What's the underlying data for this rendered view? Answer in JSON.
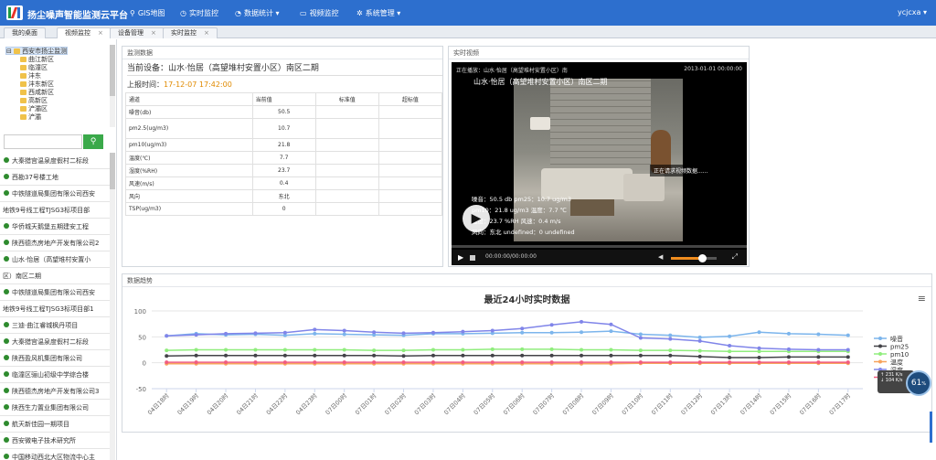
{
  "app": {
    "title": "扬尘噪声智能监测云平台",
    "user": "ycjcxa ▾"
  },
  "nav": [
    {
      "label": "GIS地图",
      "icon": "map-pin-icon",
      "glyph": "⚲"
    },
    {
      "label": "实时监控",
      "icon": "clock-icon",
      "glyph": "◷"
    },
    {
      "label": "数据统计 ▾",
      "icon": "stats-icon",
      "glyph": "◔"
    },
    {
      "label": "视频监控",
      "icon": "video-icon",
      "glyph": "▭"
    },
    {
      "label": "系统管理 ▾",
      "icon": "gear-icon",
      "glyph": "✲"
    }
  ],
  "tabs": [
    {
      "label": "我的桌面",
      "closable": false,
      "active": false
    },
    {
      "label": "视频监控",
      "closable": true,
      "active": true
    },
    {
      "label": "设备管理",
      "closable": true,
      "active": false
    },
    {
      "label": "实时监控",
      "closable": true,
      "active": false
    }
  ],
  "tree": {
    "root": "西安市扬尘监测",
    "children": [
      "曲江新区",
      "临潼区",
      "沣东",
      "沣东新区",
      "西咸新区",
      "高新区",
      "浐灞区",
      "浐灞"
    ]
  },
  "search": {
    "placeholder": "",
    "button": "⚲"
  },
  "sites": [
    {
      "text": "大秦猎宫温泉度假村二标段",
      "dot": true
    },
    {
      "text": "西勘37号楼工地",
      "dot": true
    },
    {
      "text": "中铁隧道局集团有限公司西安",
      "dot": true
    },
    {
      "text": "地铁9号线工程TJSG3标项目部",
      "dot": false
    },
    {
      "text": "华侨城天鹅堡五期建安工程",
      "dot": true
    },
    {
      "text": "陕西德杰房地产开发有限公司2",
      "dot": true
    },
    {
      "text": "山水·怡居（高望堆村安置小",
      "dot": true
    },
    {
      "text": "区）南区二期",
      "dot": false
    },
    {
      "text": "中铁隧道局集团有限公司西安",
      "dot": true
    },
    {
      "text": "地铁9号线工程TJSG3标项目部1",
      "dot": false
    },
    {
      "text": "三迪·曲江睿城枫丹项目",
      "dot": true
    },
    {
      "text": "大秦猎宫温泉度假村二标段",
      "dot": true
    },
    {
      "text": "陕西盈风机集团有限公司",
      "dot": true
    },
    {
      "text": "临潼区骊山初级中学综合楼",
      "dot": true
    },
    {
      "text": "陕西德杰房地产开发有限公司3",
      "dot": true
    },
    {
      "text": "陕西生力置业集团有限公司",
      "dot": true
    },
    {
      "text": "航天新佳园一期项目",
      "dot": true
    },
    {
      "text": "西安微电子技术研究所",
      "dot": true
    },
    {
      "text": "中国移动西北大区物流中心主",
      "dot": true
    }
  ],
  "monitor": {
    "title": "监测数据",
    "device_label": "当前设备：山水·怡居（高望堆村安置小区）南区二期",
    "report_label": "上报时间：",
    "report_time": "17-12-07 17:42:00",
    "headers": [
      "通道",
      "当前值",
      "标准值",
      "超标值"
    ],
    "rows": [
      [
        "噪音(db)",
        "50.5",
        "",
        ""
      ],
      [
        "pm2.5(ug/m3)",
        "10.7",
        "",
        ""
      ],
      [
        "pm10(ug/m3)",
        "21.8",
        "",
        ""
      ],
      [
        "温度(℃)",
        "7.7",
        "",
        ""
      ],
      [
        "湿度(%RH)",
        "23.7",
        "",
        ""
      ],
      [
        "风速(m/s)",
        "0.4",
        "",
        ""
      ],
      [
        "风向",
        "东北",
        "",
        ""
      ],
      [
        "TSP(ug/m3)",
        "0",
        "",
        ""
      ]
    ]
  },
  "video": {
    "title": "实时视频",
    "playing": "正在播放：山水·怡居（高望堆村安置小区）南",
    "stamp": "2013-01-01  00:00:00",
    "caption": "山水·怡居（高望堆村安置小区）南区二期",
    "loading": "正在请求视频数据......",
    "line1": "噪音：50.5 db    pm25：10.7 ug/m3",
    "line2": "pm10：21.8 ug/m3    温度：7.7 ℃",
    "line3": "湿度：23.7 %RH    风速：0.4 m/s",
    "line4": "风向：东北    undefined：0 undefined",
    "time": "00:00:00/00:00:00",
    "play": "▶",
    "volume": "◀",
    "fullscreen": "⤢"
  },
  "trend": {
    "title": "数据趋势"
  },
  "gauge": {
    "value": "61",
    "unit": "%",
    "up": "231 K/s",
    "down": "104 K/s"
  },
  "chart_data": {
    "type": "line",
    "title": "最近24小时实时数据",
    "ylim": [
      -50,
      100
    ],
    "yticks": [
      -50,
      0,
      50,
      100
    ],
    "categories": [
      "04日18时",
      "04日19时",
      "04日20时",
      "04日21时",
      "04日22时",
      "04日23时",
      "07日00时",
      "07日01时",
      "07日02时",
      "07日03时",
      "07日04时",
      "07日05时",
      "07日06时",
      "07日07时",
      "07日08时",
      "07日09时",
      "07日10时",
      "07日11时",
      "07日12时",
      "07日13时",
      "07日14时",
      "07日15时",
      "07日16时",
      "07日17时"
    ],
    "legend_position": "right",
    "series": [
      {
        "name": "噪音",
        "color": "#7cb5ec",
        "values": [
          52,
          56,
          54,
          55,
          53,
          56,
          55,
          54,
          53,
          56,
          56,
          57,
          58,
          58,
          59,
          61,
          55,
          53,
          49,
          51,
          59,
          56,
          55,
          53
        ]
      },
      {
        "name": "pm25",
        "color": "#434348",
        "values": [
          13,
          14,
          14,
          14,
          14,
          14,
          14,
          14,
          13,
          14,
          14,
          14,
          14,
          14,
          14,
          14,
          14,
          14,
          12,
          10,
          10,
          11,
          11,
          11
        ]
      },
      {
        "name": "pm10",
        "color": "#90ed7d",
        "values": [
          24,
          25,
          25,
          25,
          25,
          25,
          25,
          24,
          24,
          25,
          25,
          26,
          26,
          26,
          25,
          25,
          24,
          24,
          23,
          22,
          22,
          22,
          22,
          22
        ]
      },
      {
        "name": "温度",
        "color": "#f7a35c",
        "values": [
          -2,
          -2,
          -2,
          -2,
          -2,
          -2,
          -2,
          -2,
          -2,
          -2,
          -2,
          -2,
          -2,
          -2,
          -2,
          -2,
          -1,
          -1,
          -1,
          -1,
          -1,
          -1,
          -1,
          -1
        ]
      },
      {
        "name": "湿度",
        "color": "#8085e9",
        "values": [
          52,
          54,
          56,
          57,
          58,
          64,
          62,
          59,
          57,
          58,
          60,
          62,
          66,
          73,
          79,
          74,
          48,
          46,
          42,
          33,
          28,
          26,
          25,
          25
        ]
      },
      {
        "name": "风速",
        "color": "#f15c80",
        "values": [
          1,
          1,
          1,
          1,
          1,
          1,
          1,
          1,
          1,
          1,
          1,
          1,
          1,
          1,
          1,
          1,
          1,
          1,
          1,
          1,
          1,
          1,
          1,
          1
        ]
      }
    ]
  }
}
